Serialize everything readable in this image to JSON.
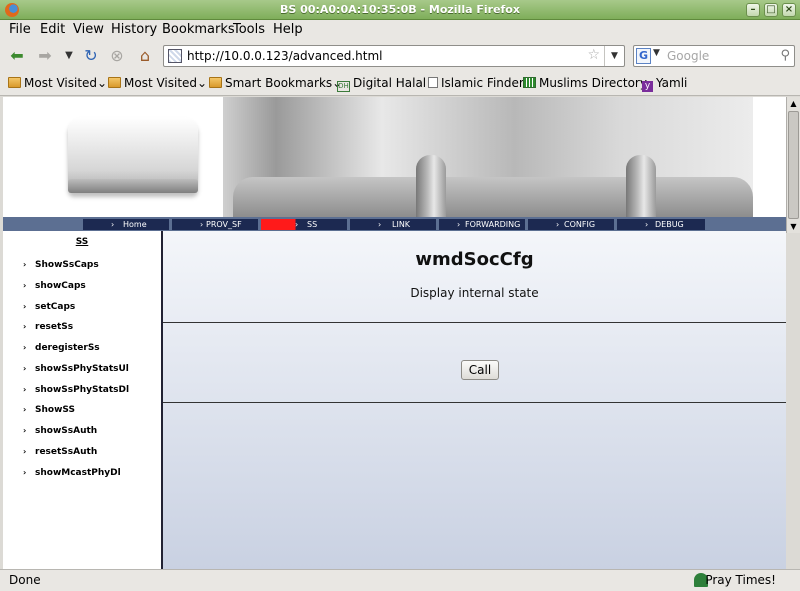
{
  "window": {
    "title": "BS 00:A0:0A:10:35:0B - Mozilla Firefox"
  },
  "menubar": [
    "File",
    "Edit",
    "View",
    "History",
    "Bookmarks",
    "Tools",
    "Help"
  ],
  "navbar": {
    "url": "http://10.0.0.123/advanced.html",
    "search_placeholder": "Google"
  },
  "bookmarks": [
    {
      "label": "Most Visited",
      "icon": "folder-icon",
      "dropdown": true
    },
    {
      "label": "Most Visited",
      "icon": "folder-icon",
      "dropdown": true
    },
    {
      "label": "Smart Bookmarks",
      "icon": "folder-icon",
      "dropdown": true
    },
    {
      "label": "Digital Halal",
      "icon": "dh-icon",
      "dropdown": false
    },
    {
      "label": "Islamic Finder",
      "icon": "page-icon",
      "dropdown": false
    },
    {
      "label": "Muslims Directory",
      "icon": "grid-icon",
      "dropdown": false
    },
    {
      "label": "Yamli",
      "icon": "yamli-icon",
      "dropdown": false
    }
  ],
  "nav_tabs": [
    {
      "label": "Home",
      "active": false
    },
    {
      "label": "PROV_SF",
      "active": false
    },
    {
      "label": "SS",
      "active": true
    },
    {
      "label": "LINK",
      "active": false
    },
    {
      "label": "FORWARDING",
      "active": false
    },
    {
      "label": "CONFIG",
      "active": false
    },
    {
      "label": "DEBUG",
      "active": false
    }
  ],
  "sidebar": {
    "heading": "SS",
    "items": [
      "ShowSsCaps",
      "showCaps",
      "setCaps",
      "resetSs",
      "deregisterSs",
      "showSsPhyStatsUl",
      "showSsPhyStatsDl",
      "ShowSS",
      "showSsAuth",
      "resetSsAuth",
      "showMcastPhyDl"
    ]
  },
  "main": {
    "title": "wmdSocCfg",
    "description": "Display internal state",
    "call_label": "Call"
  },
  "statusbar": {
    "status": "Done",
    "addon": "Pray Times!"
  },
  "colors": {
    "titlebar": "#7fae5a",
    "tabbar": "#5c6f92",
    "tab": "#1c2951",
    "tab_active": "#ff1a1a"
  }
}
